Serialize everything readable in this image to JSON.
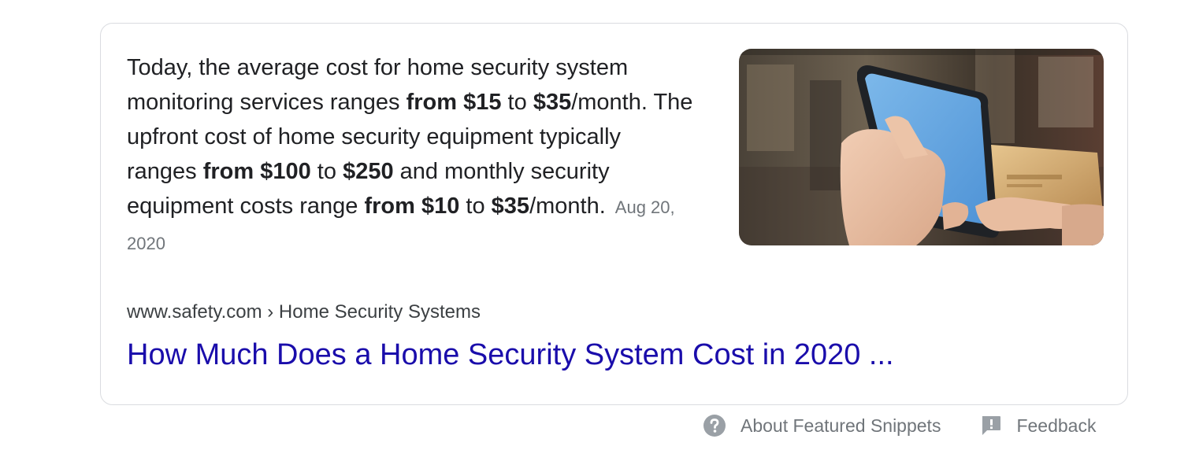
{
  "snippet": {
    "seg1": "Today, the average cost for home security system monitoring services ranges ",
    "bold1": "from $15",
    "seg2": " to ",
    "bold2": "$35",
    "seg3": "/month. The upfront cost of home security equipment typically ranges ",
    "bold3": "from $100",
    "seg4": " to ",
    "bold4": "$250",
    "seg5": " and monthly security equipment costs range ",
    "bold5": "from $10",
    "seg6": " to ",
    "bold6": "$35",
    "seg7": "/month.",
    "date": "Aug 20, 2020"
  },
  "image": {
    "alt": "Hand holding a smartphone and a credit card"
  },
  "result": {
    "breadcrumb": "www.safety.com › Home Security Systems",
    "title": "How Much Does a Home Security System Cost in 2020 ..."
  },
  "footer": {
    "about_label": "About Featured Snippets",
    "feedback_label": "Feedback"
  },
  "colors": {
    "link": "#1a0dab",
    "text": "#202124",
    "muted": "#70757a",
    "border": "#dadce0",
    "icon": "#9aa0a6"
  },
  "icons": {
    "about": "help-circle-icon",
    "feedback": "feedback-icon"
  }
}
